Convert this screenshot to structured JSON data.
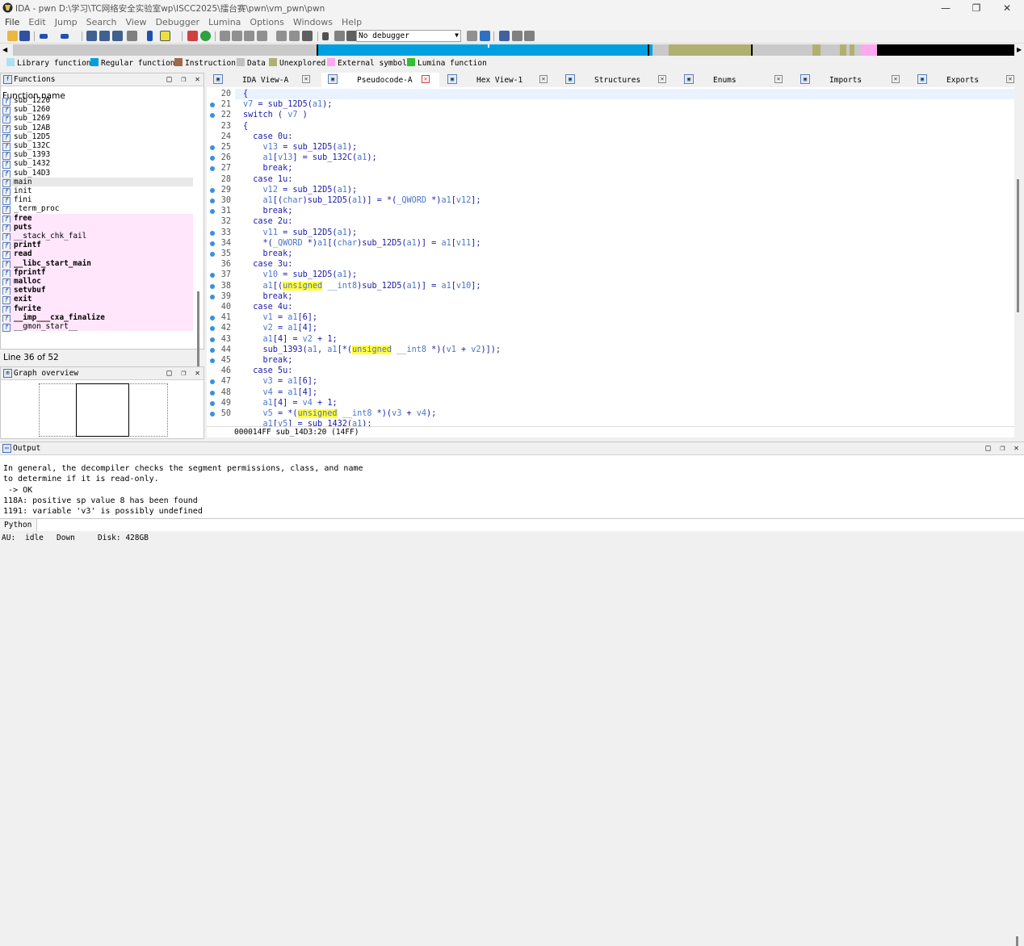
{
  "window": {
    "title": "IDA - pwn D:\\学习\\TC网络安全实验室wp\\ISCC2025\\擂台赛\\pwn\\vm_pwn\\pwn",
    "minimize": "—",
    "restore": "❐",
    "close": "✕"
  },
  "menu": [
    "File",
    "Edit",
    "Jump",
    "Search",
    "View",
    "Debugger",
    "Lumina",
    "Options",
    "Windows",
    "Help"
  ],
  "toolbar": {
    "debugger_select": "No debugger"
  },
  "legend": [
    {
      "label": "Library function",
      "color": "#aee0f5"
    },
    {
      "label": "Regular function",
      "color": "#00a0e0"
    },
    {
      "label": "Instruction",
      "color": "#a06848"
    },
    {
      "label": "Data",
      "color": "#c0c0c0"
    },
    {
      "label": "Unexplored",
      "color": "#b0b070"
    },
    {
      "label": "External symbol",
      "color": "#ffa8f0"
    },
    {
      "label": "Lumina function",
      "color": "#30c030"
    }
  ],
  "functions_panel": {
    "title": "Functions",
    "column_header": "Function name",
    "items": [
      {
        "name": "sub_1220",
        "kind": "regular"
      },
      {
        "name": "sub_1260",
        "kind": "regular"
      },
      {
        "name": "sub_1269",
        "kind": "regular"
      },
      {
        "name": "sub_12AB",
        "kind": "regular"
      },
      {
        "name": "sub_12D5",
        "kind": "regular"
      },
      {
        "name": "sub_132C",
        "kind": "regular"
      },
      {
        "name": "sub_1393",
        "kind": "regular"
      },
      {
        "name": "sub_1432",
        "kind": "regular"
      },
      {
        "name": "sub_14D3",
        "kind": "regular"
      },
      {
        "name": "main",
        "kind": "selected"
      },
      {
        "name": "init",
        "kind": "regular"
      },
      {
        "name": "fini",
        "kind": "regular"
      },
      {
        "name": "_term_proc",
        "kind": "regular"
      },
      {
        "name": "free",
        "kind": "import"
      },
      {
        "name": "puts",
        "kind": "import"
      },
      {
        "name": "__stack_chk_fail",
        "kind": "import_normal"
      },
      {
        "name": "printf",
        "kind": "import"
      },
      {
        "name": "read",
        "kind": "import"
      },
      {
        "name": "__libc_start_main",
        "kind": "import"
      },
      {
        "name": "fprintf",
        "kind": "import"
      },
      {
        "name": "malloc",
        "kind": "import"
      },
      {
        "name": "setvbuf",
        "kind": "import"
      },
      {
        "name": "exit",
        "kind": "import"
      },
      {
        "name": "fwrite",
        "kind": "import"
      },
      {
        "name": "__imp___cxa_finalize",
        "kind": "import"
      },
      {
        "name": "__gmon_start__",
        "kind": "import_normal"
      }
    ],
    "line_status": "Line 36 of 52"
  },
  "graph_panel": {
    "title": "Graph overview"
  },
  "tabs": [
    {
      "label": "IDA View-A",
      "icon": "ida-view-icon"
    },
    {
      "label": "Pseudocode-A",
      "icon": "pseudocode-icon",
      "active": true
    },
    {
      "label": "Hex View-1",
      "icon": "hex-view-icon"
    },
    {
      "label": "Structures",
      "icon": "structures-icon"
    },
    {
      "label": "Enums",
      "icon": "enums-icon"
    },
    {
      "label": "Imports",
      "icon": "imports-icon"
    },
    {
      "label": "Exports",
      "icon": "exports-icon"
    }
  ],
  "code": {
    "lines": [
      {
        "n": "20",
        "dot": false,
        "html": "{"
      },
      {
        "n": "21",
        "dot": true,
        "html": "<span class='v'>v7</span> = sub_12D5(<span class='v'>a1</span>);"
      },
      {
        "n": "22",
        "dot": true,
        "html": "switch ( <span class='v'>v7</span> )"
      },
      {
        "n": "23",
        "dot": false,
        "html": "{"
      },
      {
        "n": "24",
        "dot": false,
        "html": "  case 0u:"
      },
      {
        "n": "25",
        "dot": true,
        "html": "    <span class='v'>v13</span> = sub_12D5(<span class='v'>a1</span>);"
      },
      {
        "n": "26",
        "dot": true,
        "html": "    <span class='v'>a1</span>[<span class='v'>v13</span>] = sub_132C(<span class='v'>a1</span>);"
      },
      {
        "n": "27",
        "dot": true,
        "html": "    break;"
      },
      {
        "n": "28",
        "dot": false,
        "html": "  case 1u:"
      },
      {
        "n": "29",
        "dot": true,
        "html": "    <span class='v'>v12</span> = sub_12D5(<span class='v'>a1</span>);"
      },
      {
        "n": "30",
        "dot": true,
        "html": "    <span class='v'>a1</span>[(<span class='v'>char</span>)sub_12D5(<span class='v'>a1</span>)] = *(<span class='v'>_QWORD</span> *)<span class='v'>a1</span>[<span class='v'>v12</span>];"
      },
      {
        "n": "31",
        "dot": true,
        "html": "    break;"
      },
      {
        "n": "32",
        "dot": false,
        "html": "  case 2u:"
      },
      {
        "n": "33",
        "dot": true,
        "html": "    <span class='v'>v11</span> = sub_12D5(<span class='v'>a1</span>);"
      },
      {
        "n": "34",
        "dot": true,
        "html": "    *(<span class='v'>_QWORD</span> *)<span class='v'>a1</span>[(<span class='v'>char</span>)sub_12D5(<span class='v'>a1</span>)] = <span class='v'>a1</span>[<span class='v'>v11</span>];"
      },
      {
        "n": "35",
        "dot": true,
        "html": "    break;"
      },
      {
        "n": "36",
        "dot": false,
        "html": "  case 3u:"
      },
      {
        "n": "37",
        "dot": true,
        "html": "    <span class='v'>v10</span> = sub_12D5(<span class='v'>a1</span>);"
      },
      {
        "n": "38",
        "dot": true,
        "html": "    <span class='v'>a1</span>[(<span class='hl'>unsigned</span> <span class='v'>__int8</span>)sub_12D5(<span class='v'>a1</span>)] = <span class='v'>a1</span>[<span class='v'>v10</span>];"
      },
      {
        "n": "39",
        "dot": true,
        "html": "    break;"
      },
      {
        "n": "40",
        "dot": false,
        "html": "  case 4u:"
      },
      {
        "n": "41",
        "dot": true,
        "html": "    <span class='v'>v1</span> = <span class='v'>a1</span>[6];"
      },
      {
        "n": "42",
        "dot": true,
        "html": "    <span class='v'>v2</span> = <span class='v'>a1</span>[4];"
      },
      {
        "n": "43",
        "dot": true,
        "html": "    <span class='v'>a1</span>[4] = <span class='v'>v2</span> + 1;"
      },
      {
        "n": "44",
        "dot": true,
        "html": "    sub_1393(<span class='v'>a1</span>, <span class='v'>a1</span>[*(<span class='hl'>unsigned</span> <span class='v'>__int8</span> *)(<span class='v'>v1</span> + <span class='v'>v2</span>)]);"
      },
      {
        "n": "45",
        "dot": true,
        "html": "    break;"
      },
      {
        "n": "46",
        "dot": false,
        "html": "  case 5u:"
      },
      {
        "n": "47",
        "dot": true,
        "html": "    <span class='v'>v3</span> = <span class='v'>a1</span>[6];"
      },
      {
        "n": "48",
        "dot": true,
        "html": "    <span class='v'>v4</span> = <span class='v'>a1</span>[4];"
      },
      {
        "n": "49",
        "dot": true,
        "html": "    <span class='v'>a1</span>[4] = <span class='v'>v4</span> + 1;"
      },
      {
        "n": "50",
        "dot": true,
        "html": "    <span class='v'>v5</span> = *(<span class='hl'>unsigned</span> <span class='v'>__int8</span> *)(<span class='v'>v3</span> + <span class='v'>v4</span>);"
      },
      {
        "n": "",
        "dot": false,
        "html": "    <span class='v'>a1</span>[<span class='v'>v5</span>] = sub_1432(<span class='v'>a1</span>);"
      }
    ],
    "status": "000014FF sub_14D3:20 (14FF)"
  },
  "output_panel": {
    "title": "Output",
    "lines": [
      "In general, the decompiler checks the segment permissions, class, and name",
      "to determine if it is read-only.",
      " -> OK",
      "118A: positive sp value 8 has been found",
      "1191: variable 'v3' is possibly undefined"
    ]
  },
  "console": {
    "label": "Python",
    "value": ""
  },
  "statusbar": {
    "au": "AU:",
    "state": "idle",
    "direction": "Down",
    "disk": "Disk: 428GB"
  }
}
